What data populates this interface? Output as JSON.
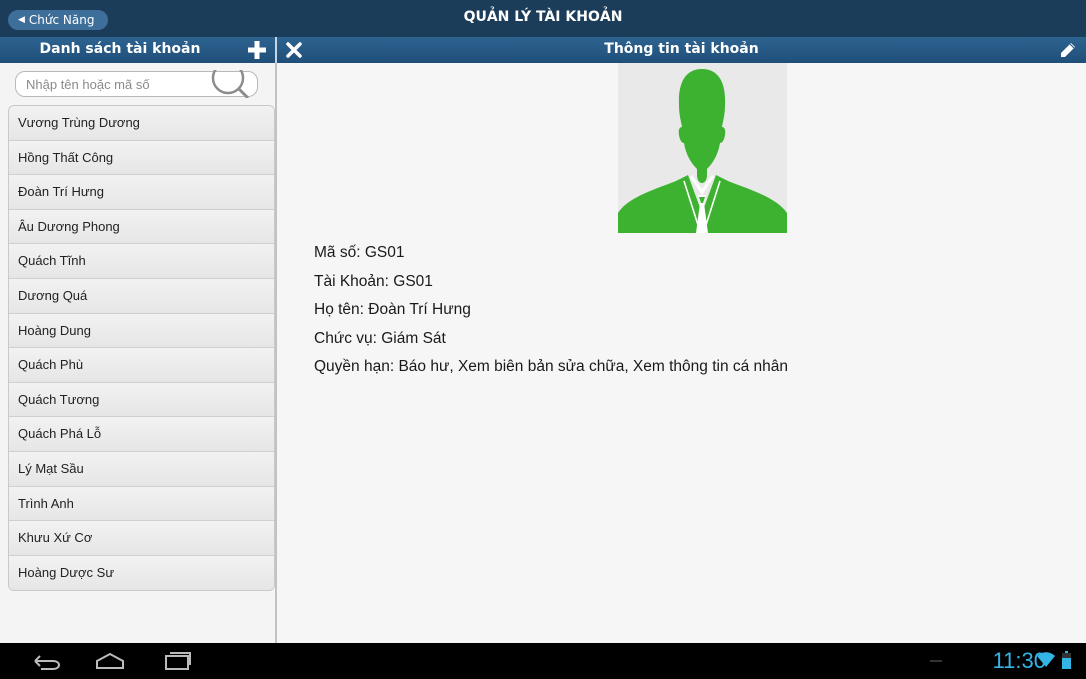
{
  "app": {
    "back_label": "Chức Năng",
    "title": "QUẢN LÝ TÀI KHOẢN"
  },
  "left_header": {
    "title": "Danh sách tài khoản",
    "add_icon": "plus-icon"
  },
  "right_header": {
    "title": "Thông tin tài khoản",
    "close_icon": "close-icon",
    "edit_icon": "pencil-icon"
  },
  "search": {
    "placeholder": "Nhập tên hoặc mã số",
    "value": ""
  },
  "accounts": [
    "Vương Trùng Dương",
    "Hồng Thất Công",
    "Đoàn Trí Hưng",
    "Âu Dương Phong",
    "Quách Tĩnh",
    "Dương Quá",
    "Hoàng Dung",
    "Quách Phù",
    "Quách Tương",
    "Quách Phá Lỗ",
    "Lý Mạt Sầu",
    "Trình Anh",
    "Khưu Xứ Cơ",
    "Hoàng Dược Sư"
  ],
  "detail": {
    "avatar_icon": "person-silhouette-icon",
    "rows": [
      "Mã số: GS01",
      "Tài Khoản: GS01",
      "Họ tên: Đoàn Trí Hưng",
      "Chức vụ: Giám Sát",
      "Quyền hạn: Báo hư, Xem biên bản sửa chữa, Xem thông tin cá nhân"
    ]
  },
  "system_bar": {
    "time": "11:30",
    "icons": [
      "back-icon",
      "home-icon",
      "recent-apps-icon",
      "wifi-icon",
      "battery-icon"
    ]
  },
  "colors": {
    "title_bar": "#1c3d5a",
    "header": "#2a5a85",
    "avatar_green": "#3cb230",
    "clock": "#33b5e5"
  }
}
